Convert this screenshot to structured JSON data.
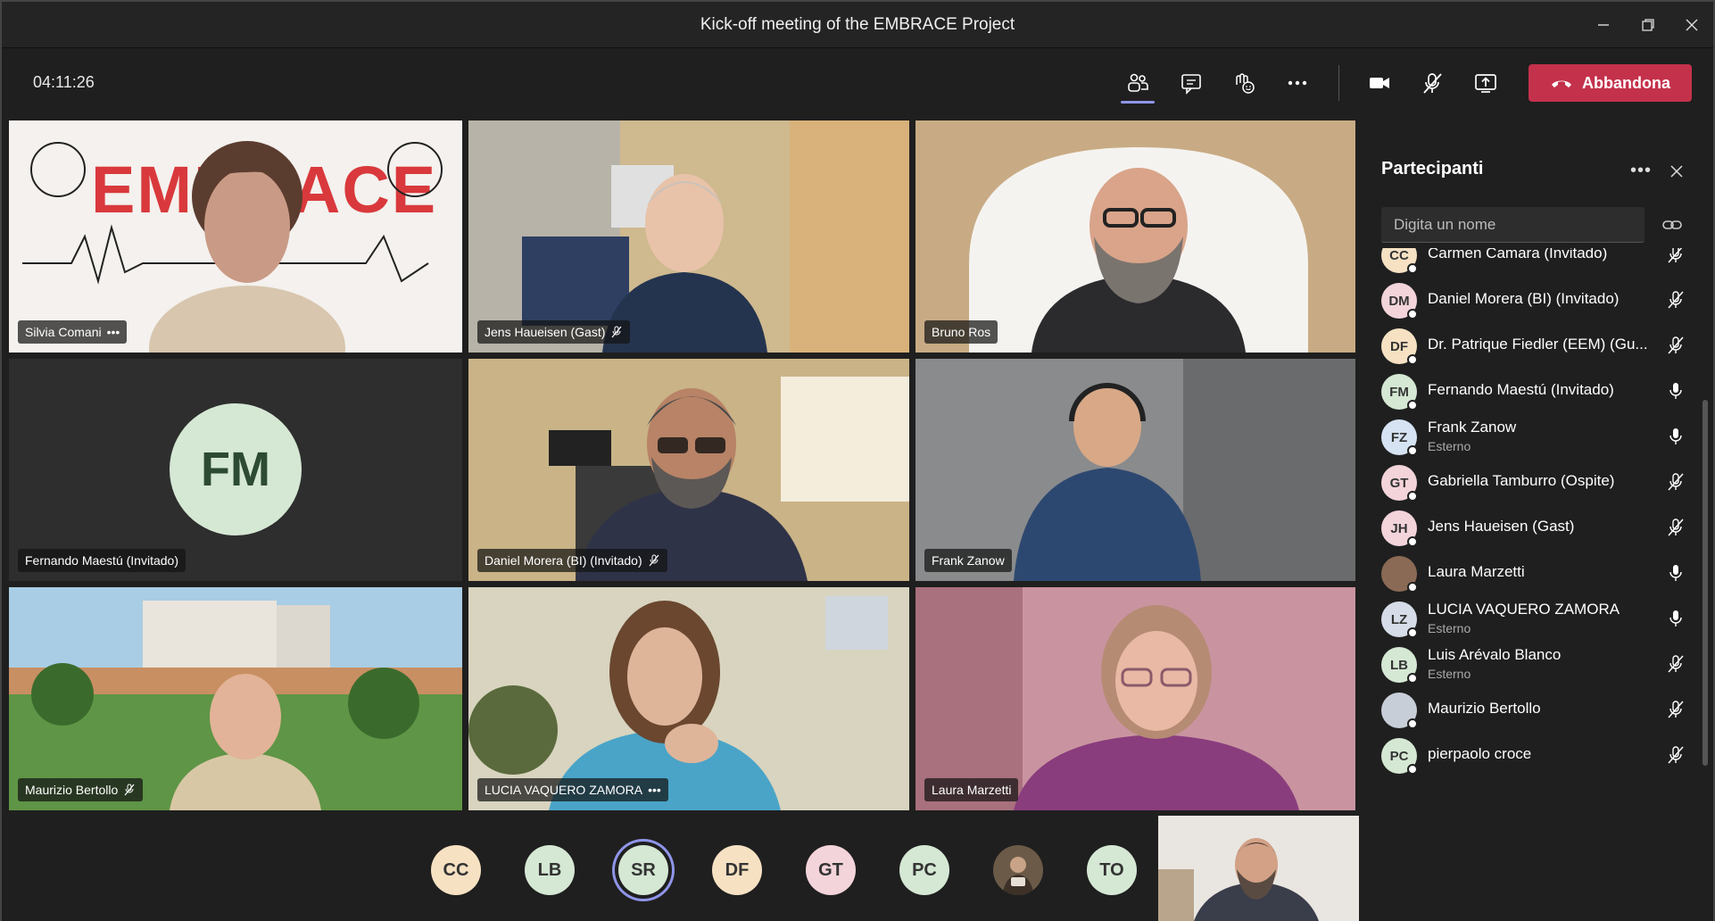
{
  "window": {
    "title": "Kick-off meeting of the EMBRACE Project",
    "controls": [
      "minimize-icon",
      "restore-icon",
      "close-icon"
    ]
  },
  "toolbar": {
    "timer": "04:11:26",
    "buttons": [
      "people-icon",
      "chat-icon",
      "reactions-icon",
      "more-icon",
      "camera-icon",
      "mic-muted-icon",
      "share-icon"
    ],
    "leave_label": "Abbandona",
    "leave_color": "#c4314b",
    "accent_color": "#8f95e8"
  },
  "tiles": [
    {
      "name": "Silvia Comani",
      "extra": "•••",
      "logo": "EMBRACE"
    },
    {
      "name": "Jens Haueisen (Gast)",
      "muted": true
    },
    {
      "name": "Bruno Ros"
    },
    {
      "name": "Fernando Maestú (Invitado)",
      "initials": "FM"
    },
    {
      "name": "Daniel Morera (BI) (Invitado)",
      "muted": true
    },
    {
      "name": "Frank Zanow"
    },
    {
      "name": "Maurizio Bertollo",
      "muted": true
    },
    {
      "name": "LUCIA VAQUERO ZAMORA",
      "extra": "•••"
    },
    {
      "name": "Laura Marzetti"
    }
  ],
  "panel": {
    "title": "Partecipanti",
    "search_placeholder": "Digita un nome",
    "participants": [
      {
        "initials": "CC",
        "name": "Carmen Camara (Invitado)",
        "sub": "",
        "mic": "muted",
        "color": "#f6e1c3"
      },
      {
        "initials": "DM",
        "name": "Daniel Morera (BI) (Invitado)",
        "sub": "",
        "mic": "muted",
        "color": "#f3d4db"
      },
      {
        "initials": "DF",
        "name": "Dr. Patrique Fiedler (EEM) (Gu...",
        "sub": "",
        "mic": "muted",
        "color": "#f6e1c3"
      },
      {
        "initials": "FM",
        "name": "Fernando Maestú (Invitado)",
        "sub": "",
        "mic": "on",
        "color": "#d5e8d4"
      },
      {
        "initials": "FZ",
        "name": "Frank Zanow",
        "sub": "Esterno",
        "mic": "on",
        "color": "#d6e3f3"
      },
      {
        "initials": "GT",
        "name": "Gabriella Tamburro (Ospite)",
        "sub": "",
        "mic": "muted",
        "color": "#f3d4db"
      },
      {
        "initials": "JH",
        "name": "Jens Haueisen (Gast)",
        "sub": "",
        "mic": "muted",
        "color": "#f3d4db"
      },
      {
        "initials": "",
        "name": "Laura Marzetti",
        "sub": "",
        "mic": "on",
        "color": "#8a6a55"
      },
      {
        "initials": "LZ",
        "name": "LUCIA VAQUERO ZAMORA",
        "sub": "Esterno",
        "mic": "on",
        "color": "#d6dde8"
      },
      {
        "initials": "LB",
        "name": "Luis Arévalo Blanco",
        "sub": "Esterno",
        "mic": "muted",
        "color": "#d5e8d4"
      },
      {
        "initials": "",
        "name": "Maurizio Bertollo",
        "sub": "",
        "mic": "muted",
        "color": "#c7ced8"
      },
      {
        "initials": "PC",
        "name": "pierpaolo croce",
        "sub": "",
        "mic": "muted",
        "color": "#d5e8d4"
      }
    ]
  },
  "bottom_row": [
    {
      "initials": "CC",
      "color": "#f6e1c3"
    },
    {
      "initials": "LB",
      "color": "#d5e8d4"
    },
    {
      "initials": "SR",
      "color": "#d5e8d4",
      "speaking": true
    },
    {
      "initials": "DF",
      "color": "#f6e1c3"
    },
    {
      "initials": "GT",
      "color": "#f3d4db"
    },
    {
      "initials": "PC",
      "color": "#d5e8d4"
    },
    {
      "initials": "",
      "color": "#6b5a48"
    },
    {
      "initials": "TO",
      "color": "#d5e8d4"
    }
  ]
}
